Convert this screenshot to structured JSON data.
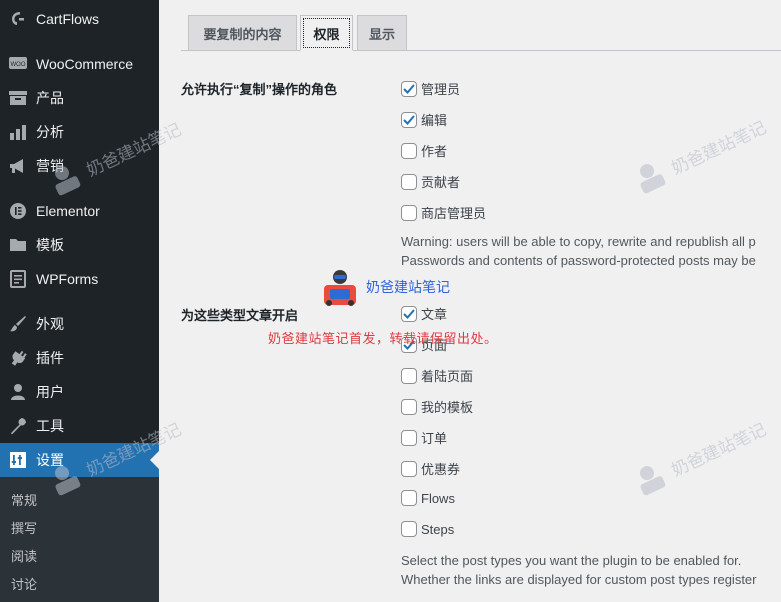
{
  "sidebar": {
    "items": [
      {
        "label": "CartFlows",
        "icon": "cartflows-icon"
      },
      {
        "label": "WooCommerce",
        "icon": "woocommerce-icon"
      },
      {
        "label": "产品",
        "icon": "archive-icon"
      },
      {
        "label": "分析",
        "icon": "bar-chart-icon"
      },
      {
        "label": "营销",
        "icon": "megaphone-icon"
      },
      {
        "label": "Elementor",
        "icon": "elementor-icon"
      },
      {
        "label": "模板",
        "icon": "folder-icon"
      },
      {
        "label": "WPForms",
        "icon": "wpforms-icon"
      },
      {
        "label": "外观",
        "icon": "paintbrush-icon"
      },
      {
        "label": "插件",
        "icon": "plugin-icon"
      },
      {
        "label": "用户",
        "icon": "user-icon"
      },
      {
        "label": "工具",
        "icon": "wrench-icon"
      },
      {
        "label": "设置",
        "icon": "settings-icon",
        "active": true
      }
    ],
    "submenu": [
      "常规",
      "撰写",
      "阅读",
      "讨论"
    ]
  },
  "tabs": [
    {
      "label": "要复制的内容"
    },
    {
      "label": "权限",
      "active": true
    },
    {
      "label": "显示"
    }
  ],
  "roles": {
    "label": "允许执行“复制”操作的角色",
    "options": [
      {
        "label": "管理员",
        "checked": true
      },
      {
        "label": "编辑",
        "checked": true
      },
      {
        "label": "作者",
        "checked": false
      },
      {
        "label": "贡献者",
        "checked": false
      },
      {
        "label": "商店管理员",
        "checked": false
      }
    ],
    "warning_line1": "Warning: users will be able to copy, rewrite and republish all p",
    "warning_line2": "Passwords and contents of password-protected posts may be"
  },
  "post_types": {
    "label": "为这些类型文章开启",
    "options": [
      {
        "label": "文章",
        "checked": true
      },
      {
        "label": "页面",
        "checked": true
      },
      {
        "label": "着陆页面",
        "checked": false
      },
      {
        "label": "我的模板",
        "checked": false
      },
      {
        "label": "订单",
        "checked": false
      },
      {
        "label": "优惠券",
        "checked": false
      },
      {
        "label": "Flows",
        "checked": false
      },
      {
        "label": "Steps",
        "checked": false
      }
    ],
    "desc_line1": "Select the post types you want the plugin to be enabled for.",
    "desc_line2": "Whether the links are displayed for custom post types register"
  },
  "watermark": {
    "text": "奶爸建站笔记",
    "stamp_text": "奶爸建站笔记",
    "notice": "奶爸建站笔记首发，转载请保留出处。"
  },
  "colors": {
    "sidebar_bg": "#1d2327",
    "active_blue": "#2271b1",
    "checkbox_check": "#2271b1",
    "notice_red": "#e0393e"
  }
}
